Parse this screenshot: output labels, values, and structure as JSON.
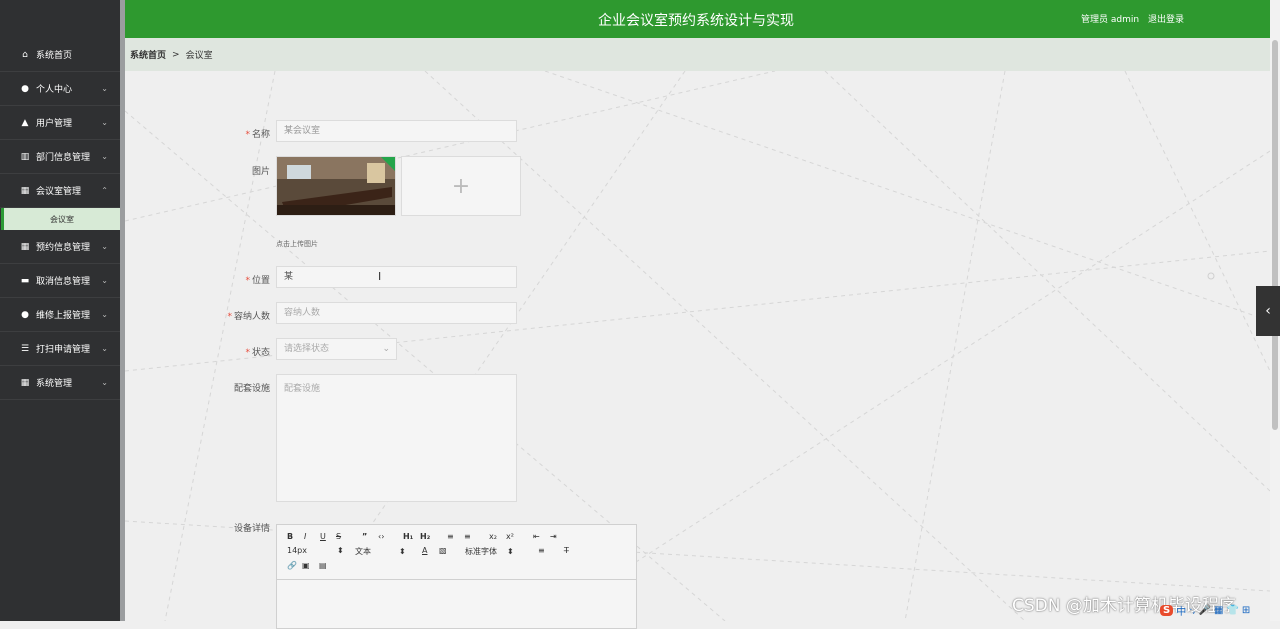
{
  "app": {
    "title": "企业会议室预约系统设计与实现",
    "user": "管理员 admin",
    "logout": "退出登录",
    "accent": "#2e992f"
  },
  "breadcrumb": [
    "系统首页",
    ">",
    "会议室"
  ],
  "sidebar": {
    "items": [
      {
        "label": "系统首页",
        "icon": "home-icon",
        "chevron": ""
      },
      {
        "label": "个人中心",
        "icon": "user-icon",
        "chevron": "v"
      },
      {
        "label": "用户管理",
        "icon": "thumb-icon",
        "chevron": "v"
      },
      {
        "label": "部门信息管理",
        "icon": "chart-icon",
        "chevron": "v"
      },
      {
        "label": "会议室管理",
        "icon": "grid-icon",
        "chevron": "^"
      },
      {
        "label": "预约信息管理",
        "icon": "grid-icon",
        "chevron": "v"
      },
      {
        "label": "取消信息管理",
        "icon": "briefcase-icon",
        "chevron": "v"
      },
      {
        "label": "维修上报管理",
        "icon": "bulb-icon",
        "chevron": "v"
      },
      {
        "label": "打扫申请管理",
        "icon": "list-icon",
        "chevron": "v"
      },
      {
        "label": "系统管理",
        "icon": "grid-icon",
        "chevron": "v"
      }
    ],
    "sub_active": "会议室"
  },
  "form": {
    "name_label": "名称",
    "name_value": "某会议室",
    "image_label": "图片",
    "upload_hint": "点击上传图片",
    "location_label": "位置",
    "location_value": "某",
    "capacity_label": "容纳人数",
    "capacity_placeholder": "容纳人数",
    "status_label": "状态",
    "status_placeholder": "请选择状态",
    "facility_label": "配套设施",
    "facility_placeholder": "配套设施",
    "detail_label": "设备详情"
  },
  "editor": {
    "row1": [
      "B",
      "I",
      "U",
      "S",
      "”",
      "‹›",
      "H₁",
      "H₂",
      "≡",
      "≡",
      "x₂",
      "x²",
      "⇤",
      "⇥"
    ],
    "font_size": "14px",
    "paragraph": "文本",
    "font_family": "标准字体",
    "row3": [
      "🔗",
      "▣",
      "▤"
    ]
  },
  "watermark": "CSDN @加木计算机毕设程序",
  "ime": [
    "S",
    "中",
    "·,",
    "🎤",
    "▦",
    "👕",
    "⊞"
  ]
}
